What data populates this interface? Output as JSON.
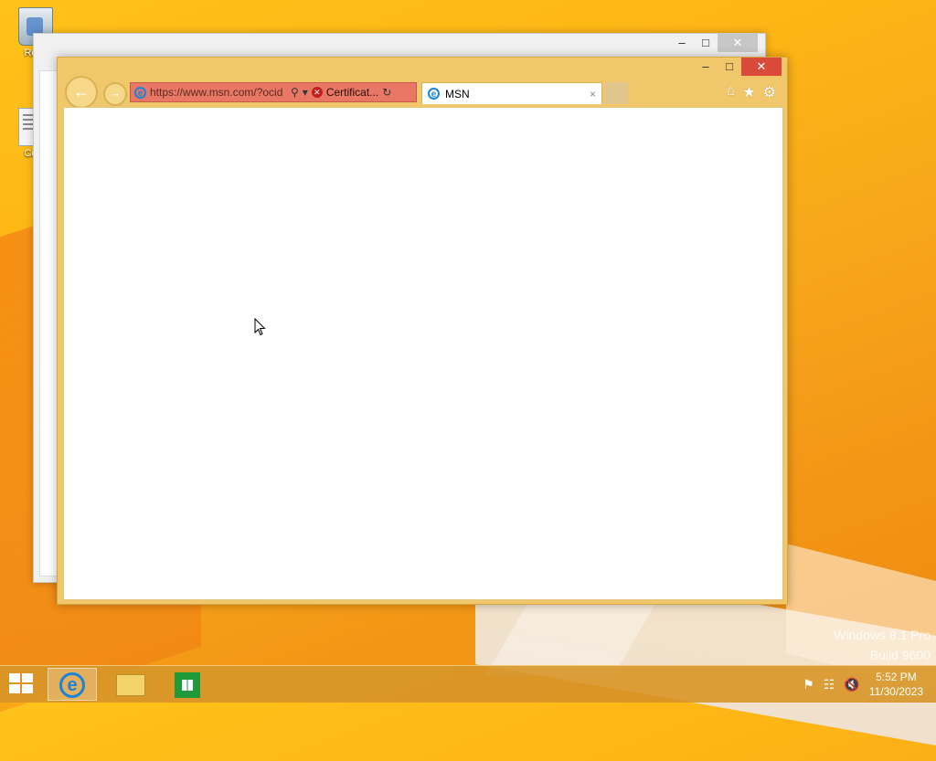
{
  "desktop": {
    "icons": [
      {
        "label": "Recy"
      },
      {
        "label": "Colla"
      }
    ],
    "watermark": {
      "line1": "Windows 8.1 Pro",
      "line2": "Build 9600"
    }
  },
  "browser": {
    "address": {
      "url": "https://www.msn.com/?ocid",
      "certificate": "Certificat..."
    },
    "tab": {
      "title": "MSN",
      "close": "×"
    },
    "window_controls": {
      "minimize": "–",
      "maximize": "□",
      "close": "✕"
    },
    "tools": {
      "home": "⌂",
      "favorites": "★",
      "settings": "⚙"
    },
    "nav": {
      "back": "←",
      "forward": "→"
    }
  },
  "taskbar": {
    "clock": {
      "time": "5:52 PM",
      "date": "11/30/2023"
    },
    "apps": [
      "Internet Explorer",
      "File Explorer",
      "Store"
    ]
  }
}
